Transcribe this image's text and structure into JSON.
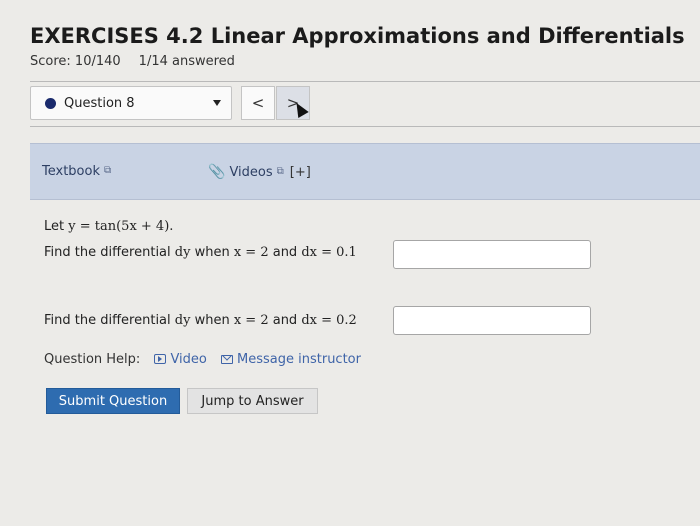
{
  "header": {
    "title": "EXERCISES 4.2 Linear Approximations and Differentials",
    "score": "Score: 10/140",
    "answered": "1/14 answered"
  },
  "question_nav": {
    "selected": "Question 8",
    "prev_label": "<",
    "next_label": ">"
  },
  "help_links": {
    "textbook": "Textbook",
    "videos": "Videos",
    "expand": "[+]"
  },
  "problem": {
    "intro_text": "Let ",
    "intro_math": "y = tan(5x + 4).",
    "q1_text": "Find the differential ",
    "q1_dy": "dy",
    "q1_when": " when ",
    "q1_cond": "x = 2",
    "q1_and": " and ",
    "q1_dx": "dx = 0.1",
    "q1_value": "",
    "q2_text": "Find the differential ",
    "q2_dy": "dy",
    "q2_when": " when ",
    "q2_cond": "x = 2",
    "q2_and": " and ",
    "q2_dx": "dx = 0.2",
    "q2_value": ""
  },
  "question_help": {
    "label": "Question Help:",
    "video": "Video",
    "message": "Message instructor"
  },
  "actions": {
    "submit": "Submit Question",
    "jump": "Jump to Answer"
  },
  "colors": {
    "accent": "#2e6cb0",
    "panel": "#c9d3e4",
    "link": "#3f64a8"
  }
}
